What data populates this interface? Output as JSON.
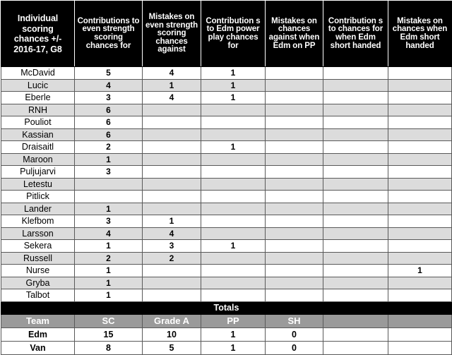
{
  "table": {
    "headers": [
      "Individual scoring chances +/- 2016-17, G8",
      "Contributions to even strength scoring chances for",
      "Mistakes on even strength scoring chances against",
      "Contribution s to Edm power play chances for",
      "Mistakes on chances against when Edm on PP",
      "Contribution s to chances for when Edm short handed",
      "Mistakes on chances when Edm short handed"
    ],
    "rows": [
      {
        "name": "McDavid",
        "es_for": "5",
        "es_against": "4",
        "pp_for": "1",
        "pp_against": "",
        "sh_for": "",
        "sh_against": ""
      },
      {
        "name": "Lucic",
        "es_for": "4",
        "es_against": "1",
        "pp_for": "1",
        "pp_against": "",
        "sh_for": "",
        "sh_against": ""
      },
      {
        "name": "Eberle",
        "es_for": "3",
        "es_against": "4",
        "pp_for": "1",
        "pp_against": "",
        "sh_for": "",
        "sh_against": ""
      },
      {
        "name": "RNH",
        "es_for": "6",
        "es_against": "",
        "pp_for": "",
        "pp_against": "",
        "sh_for": "",
        "sh_against": ""
      },
      {
        "name": "Pouliot",
        "es_for": "6",
        "es_against": "",
        "pp_for": "",
        "pp_against": "",
        "sh_for": "",
        "sh_against": ""
      },
      {
        "name": "Kassian",
        "es_for": "6",
        "es_against": "",
        "pp_for": "",
        "pp_against": "",
        "sh_for": "",
        "sh_against": ""
      },
      {
        "name": "Draisaitl",
        "es_for": "2",
        "es_against": "",
        "pp_for": "1",
        "pp_against": "",
        "sh_for": "",
        "sh_against": ""
      },
      {
        "name": "Maroon",
        "es_for": "1",
        "es_against": "",
        "pp_for": "",
        "pp_against": "",
        "sh_for": "",
        "sh_against": ""
      },
      {
        "name": "Puljujarvi",
        "es_for": "3",
        "es_against": "",
        "pp_for": "",
        "pp_against": "",
        "sh_for": "",
        "sh_against": ""
      },
      {
        "name": "Letestu",
        "es_for": "",
        "es_against": "",
        "pp_for": "",
        "pp_against": "",
        "sh_for": "",
        "sh_against": ""
      },
      {
        "name": "Pitlick",
        "es_for": "",
        "es_against": "",
        "pp_for": "",
        "pp_against": "",
        "sh_for": "",
        "sh_against": ""
      },
      {
        "name": "Lander",
        "es_for": "1",
        "es_against": "",
        "pp_for": "",
        "pp_against": "",
        "sh_for": "",
        "sh_against": ""
      },
      {
        "name": "Klefbom",
        "es_for": "3",
        "es_against": "1",
        "pp_for": "",
        "pp_against": "",
        "sh_for": "",
        "sh_against": ""
      },
      {
        "name": "Larsson",
        "es_for": "4",
        "es_against": "4",
        "pp_for": "",
        "pp_against": "",
        "sh_for": "",
        "sh_against": ""
      },
      {
        "name": "Sekera",
        "es_for": "1",
        "es_against": "3",
        "pp_for": "1",
        "pp_against": "",
        "sh_for": "",
        "sh_against": ""
      },
      {
        "name": "Russell",
        "es_for": "2",
        "es_against": "2",
        "pp_for": "",
        "pp_against": "",
        "sh_for": "",
        "sh_against": ""
      },
      {
        "name": "Nurse",
        "es_for": "1",
        "es_against": "",
        "pp_for": "",
        "pp_against": "",
        "sh_for": "",
        "sh_against": "1"
      },
      {
        "name": "Gryba",
        "es_for": "1",
        "es_against": "",
        "pp_for": "",
        "pp_against": "",
        "sh_for": "",
        "sh_against": ""
      },
      {
        "name": "Talbot",
        "es_for": "1",
        "es_against": "",
        "pp_for": "",
        "pp_against": "",
        "sh_for": "",
        "sh_against": ""
      }
    ],
    "totals": {
      "band_label": "Totals",
      "headers": [
        "Team",
        "SC",
        "Grade A",
        "PP",
        "SH",
        "",
        ""
      ],
      "rows": [
        {
          "team": "Edm",
          "sc": "15",
          "grade_a": "10",
          "pp": "1",
          "sh": "0",
          "extra1": "",
          "extra2": ""
        },
        {
          "team": "Van",
          "sc": "8",
          "grade_a": "5",
          "pp": "1",
          "sh": "0",
          "extra1": "",
          "extra2": ""
        }
      ]
    }
  },
  "colors": {
    "header_bg": "#000000",
    "header_text": "#ffffff",
    "alt_row_bg": "#dcdcdc",
    "totals_head_bg": "#9a9a9a",
    "grid_line": "#595959"
  }
}
